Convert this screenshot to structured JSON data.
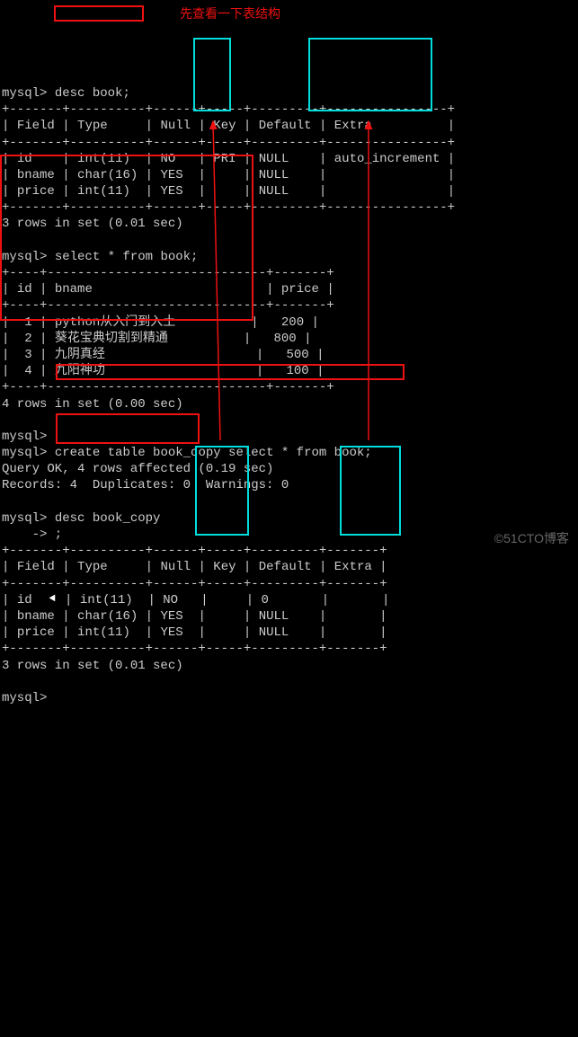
{
  "watermark": "©51CTO博客",
  "red_note": "先查看一下表结构",
  "prompt": "mysql>",
  "cmd1": "desc book;",
  "headers1": {
    "field": "Field",
    "type": "Type",
    "null": "Null",
    "key": "Key",
    "default": "Default",
    "extra": "Extra"
  },
  "rows1": [
    {
      "field": "id",
      "type": "int(11)",
      "null": "NO",
      "key": "PRI",
      "default": "NULL",
      "extra": "auto_increment"
    },
    {
      "field": "bname",
      "type": "char(16)",
      "null": "YES",
      "key": "",
      "default": "NULL",
      "extra": ""
    },
    {
      "field": "price",
      "type": "int(11)",
      "null": "YES",
      "key": "",
      "default": "NULL",
      "extra": ""
    }
  ],
  "msg1": "3 rows in set (0.01 sec)",
  "cmd2": "select * from book;",
  "headers2": {
    "id": "id",
    "bname": "bname",
    "price": "price"
  },
  "rows2": [
    {
      "id": "1",
      "bname": "python从入门到入土",
      "price": "200"
    },
    {
      "id": "2",
      "bname": "葵花宝典切割到精通",
      "price": "800"
    },
    {
      "id": "3",
      "bname": "九阴真经",
      "price": "500"
    },
    {
      "id": "4",
      "bname": "九阳神功",
      "price": "100"
    }
  ],
  "msg2": "4 rows in set (0.00 sec)",
  "cmd3": "create table book_copy select * from book;",
  "msg3a": "Query OK, 4 rows affected (0.19 sec)",
  "msg3b": "Records: 4  Duplicates: 0  Warnings: 0",
  "cmd4": "desc book_copy",
  "cmd4b": "    -> ;",
  "rows3": [
    {
      "field": "id",
      "type": "int(11)",
      "null": "NO",
      "key": "",
      "default": "0",
      "extra": ""
    },
    {
      "field": "bname",
      "type": "char(16)",
      "null": "YES",
      "key": "",
      "default": "NULL",
      "extra": ""
    },
    {
      "field": "price",
      "type": "int(11)",
      "null": "YES",
      "key": "",
      "default": "NULL",
      "extra": ""
    }
  ],
  "msg4": "3 rows in set (0.01 sec)",
  "chart_data": [
    {
      "type": "table",
      "title": "desc book",
      "columns": [
        "Field",
        "Type",
        "Null",
        "Key",
        "Default",
        "Extra"
      ],
      "rows": [
        [
          "id",
          "int(11)",
          "NO",
          "PRI",
          "NULL",
          "auto_increment"
        ],
        [
          "bname",
          "char(16)",
          "YES",
          "",
          "NULL",
          ""
        ],
        [
          "price",
          "int(11)",
          "YES",
          "",
          "NULL",
          ""
        ]
      ]
    },
    {
      "type": "table",
      "title": "select * from book",
      "columns": [
        "id",
        "bname",
        "price"
      ],
      "rows": [
        [
          "1",
          "python从入门到入土",
          200
        ],
        [
          "2",
          "葵花宝典切割到精通",
          800
        ],
        [
          "3",
          "九阴真经",
          500
        ],
        [
          "4",
          "九阳神功",
          100
        ]
      ]
    },
    {
      "type": "table",
      "title": "desc book_copy",
      "columns": [
        "Field",
        "Type",
        "Null",
        "Key",
        "Default",
        "Extra"
      ],
      "rows": [
        [
          "id",
          "int(11)",
          "NO",
          "",
          "0",
          ""
        ],
        [
          "bname",
          "char(16)",
          "YES",
          "",
          "NULL",
          ""
        ],
        [
          "price",
          "int(11)",
          "YES",
          "",
          "NULL",
          ""
        ]
      ]
    }
  ]
}
